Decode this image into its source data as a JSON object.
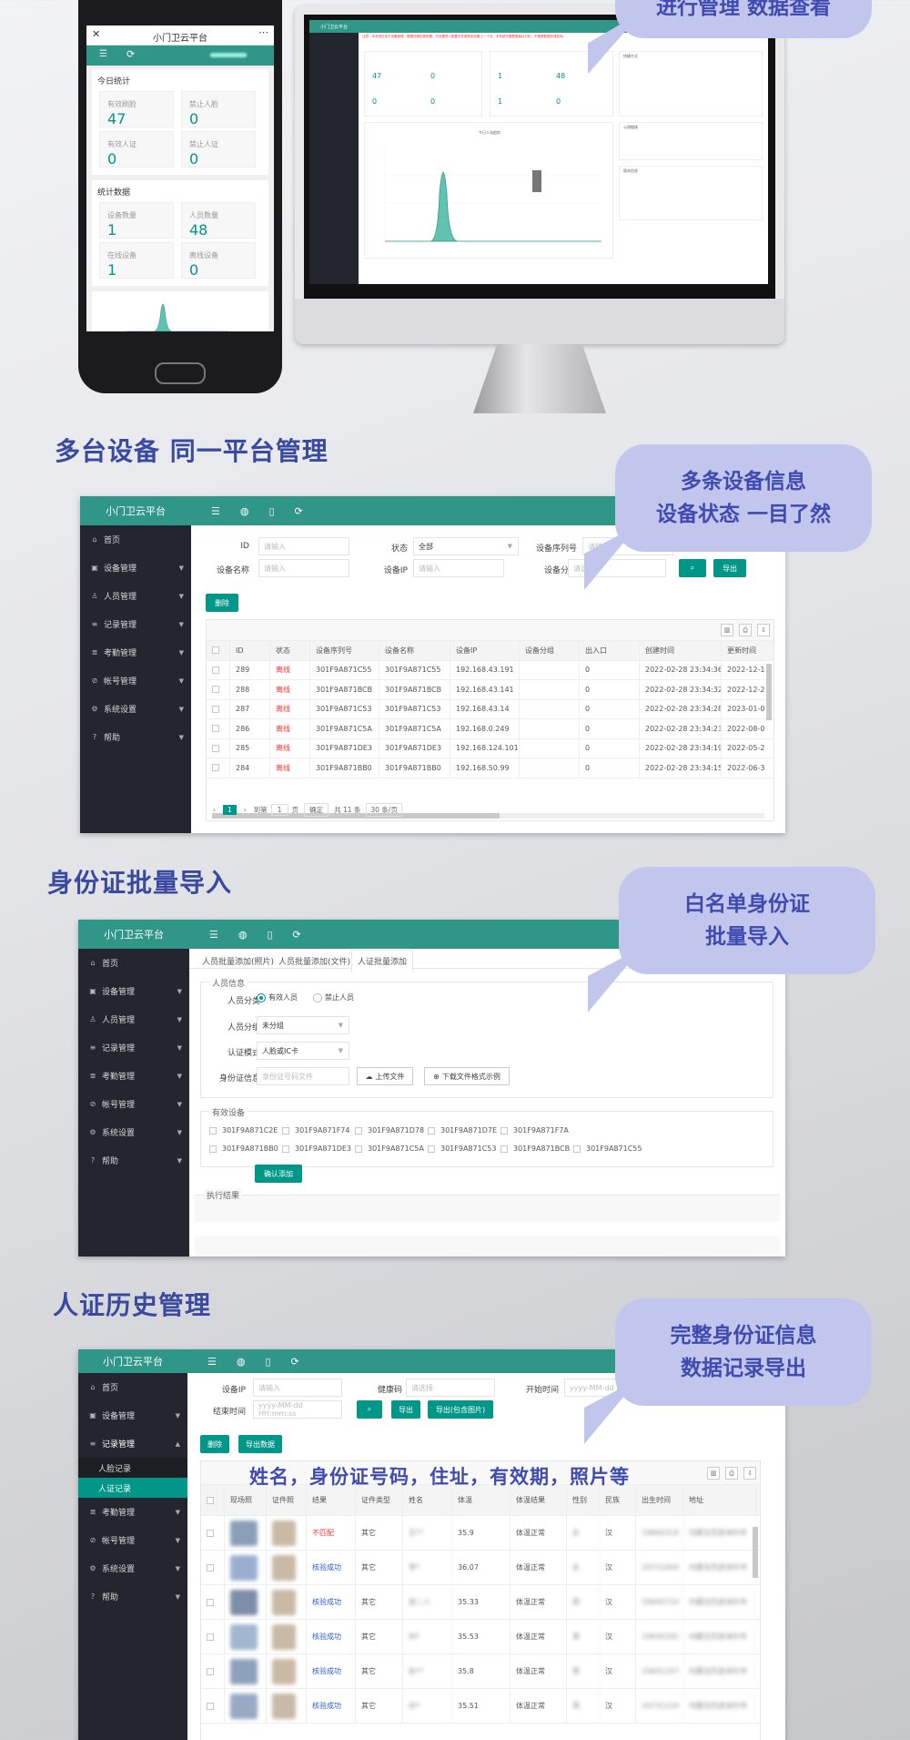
{
  "top_bubble": {
    "line1": "进行管理 数据查看"
  },
  "phone": {
    "title": "小门卫云平台",
    "today_stats_title": "今日统计",
    "today_stats": [
      {
        "label": "有效刷脸",
        "value": "47"
      },
      {
        "label": "禁止人脸",
        "value": "0"
      },
      {
        "label": "有效人证",
        "value": "0"
      },
      {
        "label": "禁止人证",
        "value": "0"
      }
    ],
    "stat_data_title": "统计数据",
    "stat_data": [
      {
        "label": "设备数量",
        "value": "1"
      },
      {
        "label": "人员数量",
        "value": "48"
      },
      {
        "label": "在线设备",
        "value": "1"
      },
      {
        "label": "离线设备",
        "value": "0"
      }
    ]
  },
  "monitor": {
    "brand": "小门卫云平台",
    "notice": "注意：本系统仅用于设备管理，数据存储在服务器，可设置导入配置文件更新到设备上一个月，本系统内置数据每月分析，不推荐数据存储查询。",
    "stats_a": [
      "47",
      "0",
      "0",
      "0"
    ],
    "stats_b": [
      "1",
      "48",
      "1",
      "0"
    ],
    "chart_title": "今日人流趋势",
    "panels": [
      "快捷方式",
      "公测链接",
      "版本信息"
    ]
  },
  "section1": {
    "heading": "多台设备 同一平台管理",
    "bubble_line1": "多条设备信息",
    "bubble_line2": "设备状态 一目了然",
    "brand": "小门卫云平台",
    "menu": [
      "首页",
      "设备管理",
      "人员管理",
      "记录管理",
      "考勤管理",
      "帐号管理",
      "系统设置",
      "帮助"
    ],
    "filters": {
      "id_label": "ID",
      "id_placeholder": "请输入",
      "status_label": "状态",
      "status_value": "全部",
      "serial_label": "设备序列号",
      "serial_placeholder": "请输入",
      "name_label": "设备名称",
      "name_placeholder": "请输入",
      "ip_label": "设备IP",
      "ip_placeholder": "请输入",
      "group_label": "设备分组",
      "group_placeholder": "请选择",
      "export_label": "导出",
      "delete_label": "删除"
    },
    "columns": [
      "ID",
      "状态",
      "设备序列号",
      "设备名称",
      "设备IP",
      "设备分组",
      "出入口",
      "创建时间",
      "更新时间"
    ],
    "rows": [
      [
        "289",
        "离线",
        "301F9A871C55",
        "301F9A871C55",
        "192.168.43.191",
        "",
        "0",
        "2022-02-28 23:34:36",
        "2022-12-1"
      ],
      [
        "288",
        "离线",
        "301F9A871BCB",
        "301F9A871BCB",
        "192.168.43.141",
        "",
        "0",
        "2022-02-28 23:34:32",
        "2022-12-2"
      ],
      [
        "287",
        "离线",
        "301F9A871C53",
        "301F9A871C53",
        "192.168.43.14",
        "",
        "0",
        "2022-02-28 23:34:28",
        "2023-01-0"
      ],
      [
        "286",
        "离线",
        "301F9A871C5A",
        "301F9A871C5A",
        "192.168.0.249",
        "",
        "0",
        "2022-02-28 23:34:23",
        "2022-08-0"
      ],
      [
        "285",
        "离线",
        "301F9A871DE3",
        "301F9A871DE3",
        "192.168.124.101",
        "",
        "0",
        "2022-02-28 23:34:19",
        "2022-05-2"
      ],
      [
        "284",
        "离线",
        "301F9A871BB0",
        "301F9A871BB0",
        "192.168.50.99",
        "",
        "0",
        "2022-02-28 23:34:15",
        "2022-06-3"
      ]
    ],
    "pager": {
      "page": "1",
      "goto": "到第",
      "page_input": "1",
      "page_unit": "页",
      "confirm": "确定",
      "total": "共 11 条",
      "per_page": "30 条/页"
    }
  },
  "section2": {
    "heading": "身份证批量导入",
    "bubble_line1": "白名单身份证",
    "bubble_line2": "批量导入",
    "tabs": [
      "人员批量添加(照片)",
      "人员批量添加(文件)",
      "人证批量添加"
    ],
    "legend_person": "人员信息",
    "category_label": "人员分类",
    "category_options": [
      "有效人员",
      "禁止人员"
    ],
    "group_label": "人员分组",
    "group_value": "未分组",
    "auth_label": "认证模式",
    "auth_value": "人脸或IC卡",
    "idinfo_label": "身份证信息",
    "idinfo_placeholder": "身份证号码文件",
    "upload_label": "上传文件",
    "download_label": "下载文件格式示例",
    "legend_device": "有效设备",
    "devices": [
      "301F9A871C2E",
      "301F9A871F74",
      "301F9A871D78",
      "301F9A871D7E",
      "301F9A871F7A",
      "301F9A871BB0",
      "301F9A871DE3",
      "301F9A871C5A",
      "301F9A871C53",
      "301F9A871BCB",
      "301F9A871C55"
    ],
    "confirm_label": "确认添加",
    "result_label": "执行结果"
  },
  "section3": {
    "heading": "人证历史管理",
    "bubble_line1": "完整身份证信息",
    "bubble_line2": "数据记录导出",
    "overlay": "姓名，身份证号码，住址，有效期，照片等",
    "menu_sub": [
      "人脸记录",
      "人证记录"
    ],
    "filters": {
      "ip_label": "设备IP",
      "ip_placeholder": "请输入",
      "health_label": "健康码",
      "health_placeholder": "请选择",
      "start_label": "开始时间",
      "start_placeholder": "yyyy-MM-dd H",
      "end_label": "结束时间",
      "end_placeholder": "yyyy-MM-dd HH:mm:ss",
      "export_label": "导出",
      "export_img_label": "导出(包含图片)",
      "delete_label": "删除",
      "export_data_label": "导出数据"
    },
    "columns": [
      "现场照",
      "证件照",
      "结果",
      "证件类型",
      "姓名",
      "体温",
      "体温结果",
      "性别",
      "民族",
      "出生时间",
      "地址"
    ],
    "rows": [
      [
        "不匹配",
        "其它",
        "王**",
        "35.9",
        "体温正常",
        "女",
        "汉",
        "19660318",
        "内蒙古巴彦淖尔市"
      ],
      [
        "核验成功",
        "其它",
        "李*",
        "36.07",
        "体温正常",
        "女",
        "汉",
        "19731004",
        "内蒙古巴彦淖尔市"
      ],
      [
        "核验成功",
        "其它",
        "张二人",
        "35.33",
        "体温正常",
        "男",
        "汉",
        "19640710",
        "内蒙古巴彦淖尔市"
      ],
      [
        "核验成功",
        "其它",
        "刘*",
        "35.53",
        "体温正常",
        "男",
        "汉",
        "19830295",
        "内蒙古巴彦淖尔市"
      ],
      [
        "核验成功",
        "其它",
        "赵**",
        "35.8",
        "体温正常",
        "男",
        "汉",
        "19691207",
        "内蒙古巴彦淖尔市"
      ],
      [
        "核验成功",
        "其它",
        "孙*",
        "35.51",
        "体温正常",
        "男",
        "汉",
        "19731219",
        "内蒙古巴彦淖尔市"
      ]
    ]
  },
  "colors": {
    "accent": "#009688",
    "sidebar": "#23262e",
    "heading": "#3a4aa0",
    "bubble": "#c2c6ec",
    "offline": "#ff3333"
  }
}
